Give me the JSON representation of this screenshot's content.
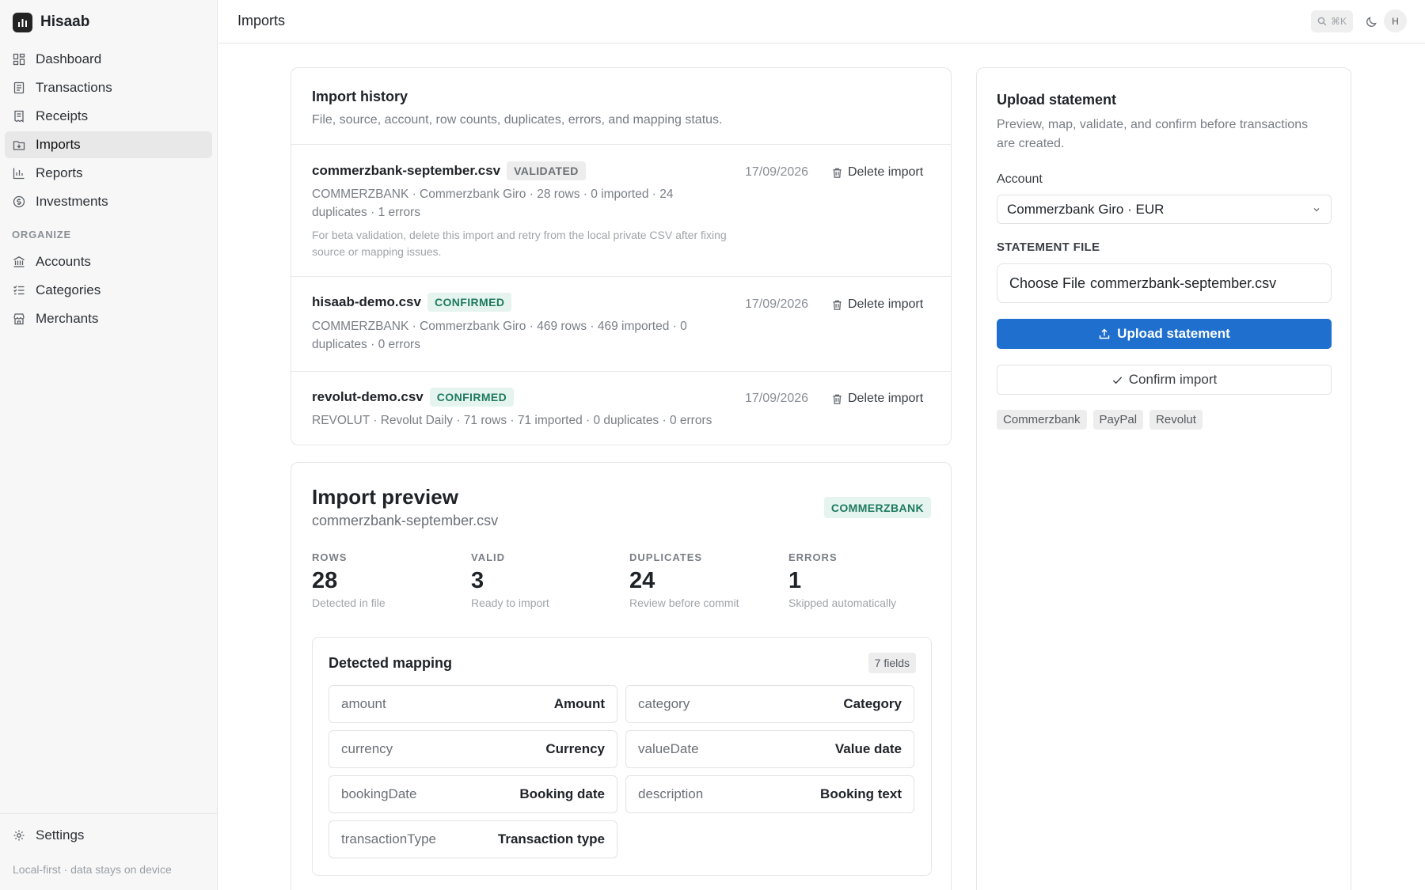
{
  "app": {
    "name": "Hisaab",
    "footnote": "Local-first · data stays on device"
  },
  "sidebar": {
    "items": [
      {
        "label": "Dashboard",
        "icon": "dashboard-icon"
      },
      {
        "label": "Transactions",
        "icon": "document-icon"
      },
      {
        "label": "Receipts",
        "icon": "receipt-icon"
      },
      {
        "label": "Imports",
        "icon": "import-icon",
        "active": true
      },
      {
        "label": "Reports",
        "icon": "bar-chart-icon"
      },
      {
        "label": "Investments",
        "icon": "dollar-circle-icon"
      }
    ],
    "section_label": "ORGANIZE",
    "organize": [
      {
        "label": "Accounts",
        "icon": "bank-icon"
      },
      {
        "label": "Categories",
        "icon": "list-check-icon"
      },
      {
        "label": "Merchants",
        "icon": "store-icon"
      }
    ],
    "settings_label": "Settings"
  },
  "topbar": {
    "title": "Imports",
    "search_shortcut": "⌘K",
    "avatar_initial": "H"
  },
  "history": {
    "title": "Import history",
    "subtitle": "File, source, account, row counts, duplicates, errors, and mapping status.",
    "delete_label": "Delete import",
    "rows": [
      {
        "file": "commerzbank-september.csv",
        "status": "VALIDATED",
        "meta": "COMMERZBANK · Commerzbank Giro · 28 rows · 0 imported · 24 duplicates · 1 errors",
        "note": "For beta validation, delete this import and retry from the local private CSV after fixing source or mapping issues.",
        "date": "17/09/2026"
      },
      {
        "file": "hisaab-demo.csv",
        "status": "CONFIRMED",
        "meta": "COMMERZBANK · Commerzbank Giro · 469 rows · 469 imported · 0 duplicates · 0 errors",
        "date": "17/09/2026"
      },
      {
        "file": "revolut-demo.csv",
        "status": "CONFIRMED",
        "meta": "REVOLUT · Revolut Daily · 71 rows · 71 imported · 0 duplicates · 0 errors",
        "date": "17/09/2026"
      }
    ]
  },
  "preview": {
    "title": "Import preview",
    "file": "commerzbank-september.csv",
    "source_badge": "COMMERZBANK",
    "stats": [
      {
        "label": "ROWS",
        "value": "28",
        "hint": "Detected in file"
      },
      {
        "label": "VALID",
        "value": "3",
        "hint": "Ready to import"
      },
      {
        "label": "DUPLICATES",
        "value": "24",
        "hint": "Review before commit"
      },
      {
        "label": "ERRORS",
        "value": "1",
        "hint": "Skipped automatically"
      }
    ],
    "mapping": {
      "title": "Detected mapping",
      "count": "7 fields",
      "fields": [
        {
          "source": "amount",
          "target": "Amount"
        },
        {
          "source": "category",
          "target": "Category"
        },
        {
          "source": "currency",
          "target": "Currency"
        },
        {
          "source": "valueDate",
          "target": "Value date"
        },
        {
          "source": "bookingDate",
          "target": "Booking date"
        },
        {
          "source": "description",
          "target": "Booking text"
        },
        {
          "source": "transactionType",
          "target": "Transaction type"
        }
      ]
    }
  },
  "upload": {
    "title": "Upload statement",
    "subtitle": "Preview, map, validate, and confirm before transactions are created.",
    "account_label": "Account",
    "account_value": "Commerzbank Giro · EUR",
    "file_label": "STATEMENT FILE",
    "file_button": "Choose File",
    "file_name": "commerzbank-september.csv",
    "upload_button": "Upload statement",
    "confirm_button": "Confirm import",
    "sources": [
      "Commerzbank",
      "PayPal",
      "Revolut"
    ]
  },
  "colors": {
    "accent": "#1f6fcf",
    "confirmed": "#1e7a5e",
    "confirmed_bg": "#e6f4ef",
    "sidebar_bg": "#f7f7f7"
  }
}
